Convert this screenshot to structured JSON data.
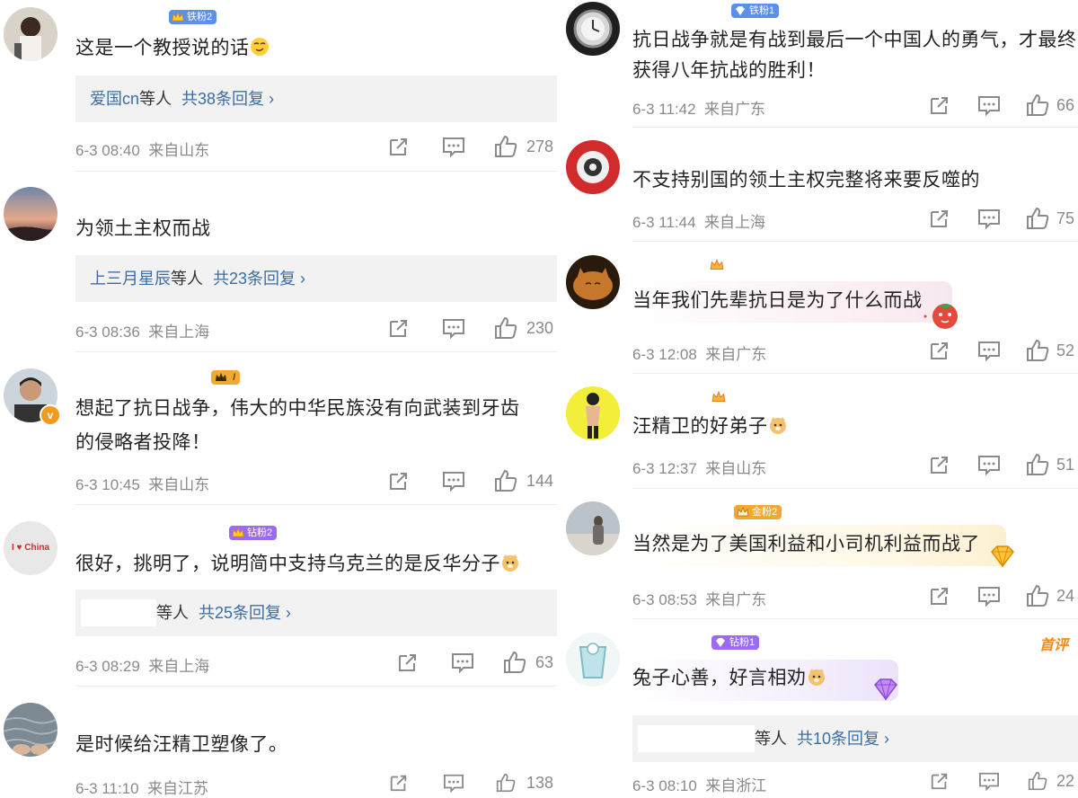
{
  "left": [
    {
      "text": "这是一个教授说的话",
      "badge": "铁粉2",
      "reply": {
        "names": "爱国cn",
        "suffix": "等人",
        "count": "共38条回复"
      },
      "time": "6-3 08:40",
      "loc": "来自山东",
      "likes": "278"
    },
    {
      "text": "为领土主权而战",
      "reply": {
        "names": "上三月星辰",
        "suffix": "等人",
        "count": "共23条回复"
      },
      "time": "6-3 08:36",
      "loc": "来自上海",
      "likes": "230"
    },
    {
      "text_l1": "想起了抗日战争，伟大的中华民族没有向武装到牙齿",
      "text_l2": "的侵略者投降！",
      "time": "6-3 10:45",
      "loc": "来自山东",
      "likes": "144"
    },
    {
      "text": "很好，挑明了，说明简中支持乌克兰的是反华分子",
      "badge": "钻粉2",
      "avatar_text": "I ♥ China",
      "reply": {
        "names": "",
        "suffix": "等人",
        "count": "共25条回复"
      },
      "time": "6-3 08:29",
      "loc": "来自上海",
      "likes": "63"
    },
    {
      "text": "是时候给汪精卫塑像了。",
      "time": "6-3 11:10",
      "loc": "来自江苏",
      "likes": "138"
    }
  ],
  "right": [
    {
      "text_l1": "抗日战争就是有战到最后一个中国人的勇气，才最终",
      "text_l2": "获得八年抗战的胜利！",
      "badge": "铁粉1",
      "time": "6-3 11:42",
      "loc": "来自广东",
      "likes": "66"
    },
    {
      "text": "不支持别国的领土主权完整将来要反噬的",
      "time": "6-3 11:44",
      "loc": "来自上海",
      "likes": "75"
    },
    {
      "text": "当年我们先辈抗日是为了什么而战",
      "time": "6-3 12:08",
      "loc": "来自广东",
      "likes": "52"
    },
    {
      "text": "汪精卫的好弟子",
      "time": "6-3 12:37",
      "loc": "来自山东",
      "likes": "51"
    },
    {
      "text": "当然是为了美国利益和小司机利益而战了",
      "badge": "金粉2",
      "time": "6-3 08:53",
      "loc": "来自广东",
      "likes": "24"
    },
    {
      "text": "兔子心善，好言相劝",
      "badge": "钻粉1",
      "first_comment": "首评",
      "reply": {
        "names": "",
        "suffix": "等人",
        "count": "共10条回复"
      },
      "time": "6-3 08:10",
      "loc": "来自浙江",
      "likes": "22"
    }
  ],
  "colors": {
    "link": "#3a6ea5",
    "meta": "#8a8a8a",
    "reply_bg": "#f2f2f2",
    "badge_blue": "#5b8fe8",
    "badge_purple": "#9b6bf0",
    "badge_gold": "#f0a933",
    "first": "#f08a1c"
  }
}
